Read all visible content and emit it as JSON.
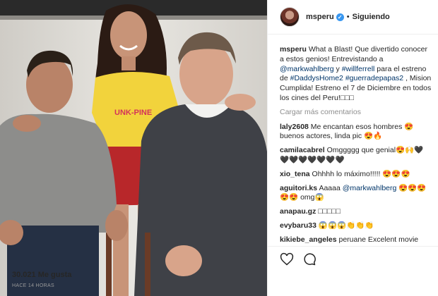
{
  "header": {
    "username": "msperu",
    "verified_icon": "verified-badge-icon",
    "separator": "•",
    "follow_status": "Siguiendo"
  },
  "caption": {
    "user": "msperu",
    "text_1": "What a Blast! Que divertido conocer a estos genios! Entrevistando a ",
    "mention_1": "@markwahlberg",
    "text_2": " y ",
    "mention_2": "#willferrell",
    "text_3": " para el estreno de ",
    "hashtag_1": "#DaddysHome2",
    "text_4": " ",
    "hashtag_2": "#guerradepapas2",
    "text_5": " , Mision Cumplida! Estreno el 7 de Diciembre en todos los cines del Peru!□□□"
  },
  "load_more": "Cargar más comentarios",
  "comments": [
    {
      "user": "laly2608",
      "text": "Me encantan esos hombres 😍 buenos actores, linda pic 😍🔥"
    },
    {
      "user": "camilacabrel",
      "text": "Omggggg que genial😍🙌🖤 🖤🖤🖤🖤🖤🖤🖤"
    },
    {
      "user": "xio_tena",
      "text": "Ohhhh lo máximo!!!!! 😍😍😍"
    },
    {
      "user": "aguitori.ks",
      "text_1": "Aaaaa ",
      "mention": "@markwahlberg",
      "text_2": " 😍😍😍 😍😍 omg😱"
    },
    {
      "user": "anapau.gz",
      "text": "□□□□□"
    },
    {
      "user": "evybaru33",
      "text": "😱😱😱👏👏👏"
    },
    {
      "user": "kikiebe_angeles",
      "text": "peruane Excelent movie"
    }
  ],
  "actions": {
    "like_icon": "heart-icon",
    "comment_icon": "comment-bubble-icon"
  },
  "likes": "30.021 Me gusta",
  "timestamp": "HACE 14 HORAS",
  "photo": {
    "shirt_text": "UNK-PINE"
  },
  "colors": {
    "link": "#003569",
    "verified": "#3897f0",
    "muted": "#8e8e8e"
  }
}
